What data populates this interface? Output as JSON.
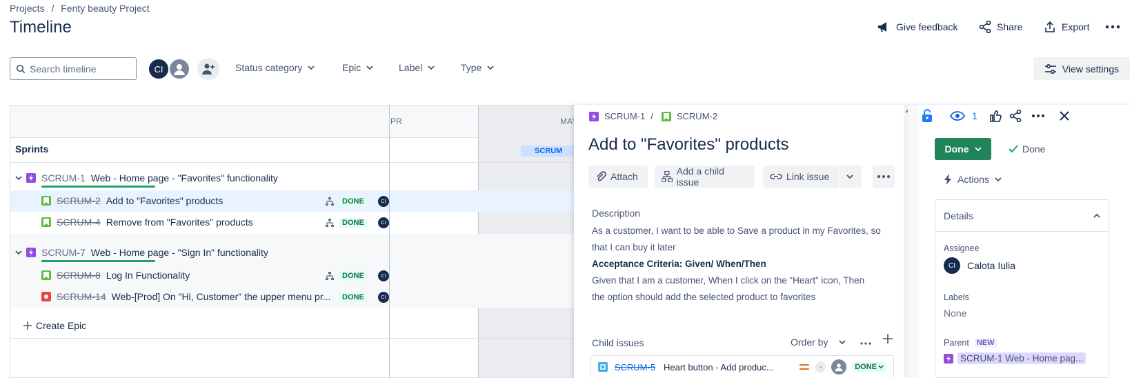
{
  "breadcrumb": {
    "projects": "Projects",
    "separator": "/",
    "project": "Fenty beauty Project"
  },
  "page_title": "Timeline",
  "header_actions": {
    "feedback": "Give feedback",
    "share": "Share",
    "export": "Export"
  },
  "search": {
    "placeholder": "Search timeline"
  },
  "avatars": {
    "user_initials": "CI"
  },
  "filters": {
    "status": "Status category",
    "epic": "Epic",
    "label": "Label",
    "type": "Type"
  },
  "view_settings": "View settings",
  "timeline": {
    "sprints_label": "Sprints",
    "month_apr": "PR",
    "month_may": "MAY",
    "sprint_chip": "SCRUM",
    "create_epic": "Create Epic",
    "epics": [
      {
        "key": "SCRUM-1",
        "title": "Web - Home page - \"Favorites\" functionality"
      },
      {
        "key": "SCRUM-7",
        "title": "Web - Home page - \"Sign In\" functionality"
      }
    ],
    "issues": [
      {
        "key": "SCRUM-2",
        "title": "Add to \"Favorites\" products",
        "status": "DONE",
        "assignee": "CI"
      },
      {
        "key": "SCRUM-4",
        "title": "Remove from \"Favorites\" products",
        "status": "DONE",
        "assignee": "CI"
      },
      {
        "key": "SCRUM-8",
        "title": "Log In Functionality",
        "status": "DONE",
        "assignee": "CI"
      },
      {
        "key": "SCRUM-14",
        "title": "Web-[Prod] On \"Hi, Customer\" the upper menu pr...",
        "status": "DONE",
        "assignee": "CI"
      }
    ]
  },
  "issue_panel": {
    "parent_key": "SCRUM-1",
    "separator": "/",
    "issue_key": "SCRUM-2",
    "title": "Add to \"Favorites\" products",
    "attach": "Attach",
    "add_child": "Add a child issue",
    "link_issue": "Link issue",
    "description_label": "Description",
    "description_line1": "As a customer, I want to be able to Save a product in my Favorites, so",
    "description_line2": "that I can buy it later",
    "acceptance_label": "Acceptance Criteria: Given/ When/Then",
    "acceptance_line1": "Given that I am a customer, When I click on the “Heart” icon, Then",
    "acceptance_line2": "the option should add the selected product to favorites",
    "child_issues_label": "Child issues",
    "order_by": "Order by",
    "child": {
      "key": "SCRUM-5",
      "title": "Heart button - Add produc...",
      "estimate": "-",
      "status": "DONE"
    }
  },
  "issue_sidebar": {
    "watch_count": "1",
    "status_button": "Done",
    "status_text": "Done",
    "actions": "Actions",
    "details": "Details",
    "assignee_label": "Assignee",
    "assignee_initials": "CI",
    "assignee_name": "Calota Iulia",
    "labels_label": "Labels",
    "labels_value": "None",
    "parent_label": "Parent",
    "parent_badge": "NEW",
    "parent_value": "SCRUM-1 Web - Home pag..."
  },
  "colors": {
    "epic": "#904ee2",
    "story": "#63ba3c",
    "bug": "#e5493a",
    "done_green": "#1f845a",
    "link_blue": "#0c66e4"
  }
}
